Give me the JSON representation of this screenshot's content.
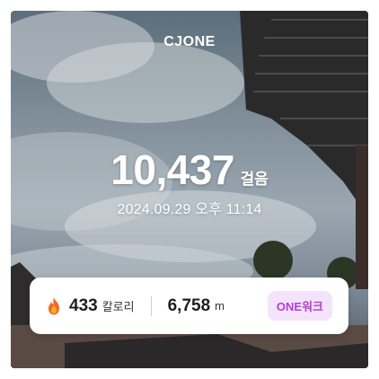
{
  "brand": {
    "logo_text": "CJONE"
  },
  "steps": {
    "value": "10,437",
    "unit": "걸음"
  },
  "datetime": "2024.09.29  오후 11:14",
  "stats": {
    "calories": {
      "value": "433",
      "unit": "칼로리",
      "icon": "fire-icon"
    },
    "distance": {
      "value": "6,758",
      "unit": "m"
    },
    "badge_label": "ONE워크"
  },
  "colors": {
    "badge_text": "#b23dd3",
    "badge_bg": "#f4e4fb",
    "card_bg": "#ffffff"
  }
}
